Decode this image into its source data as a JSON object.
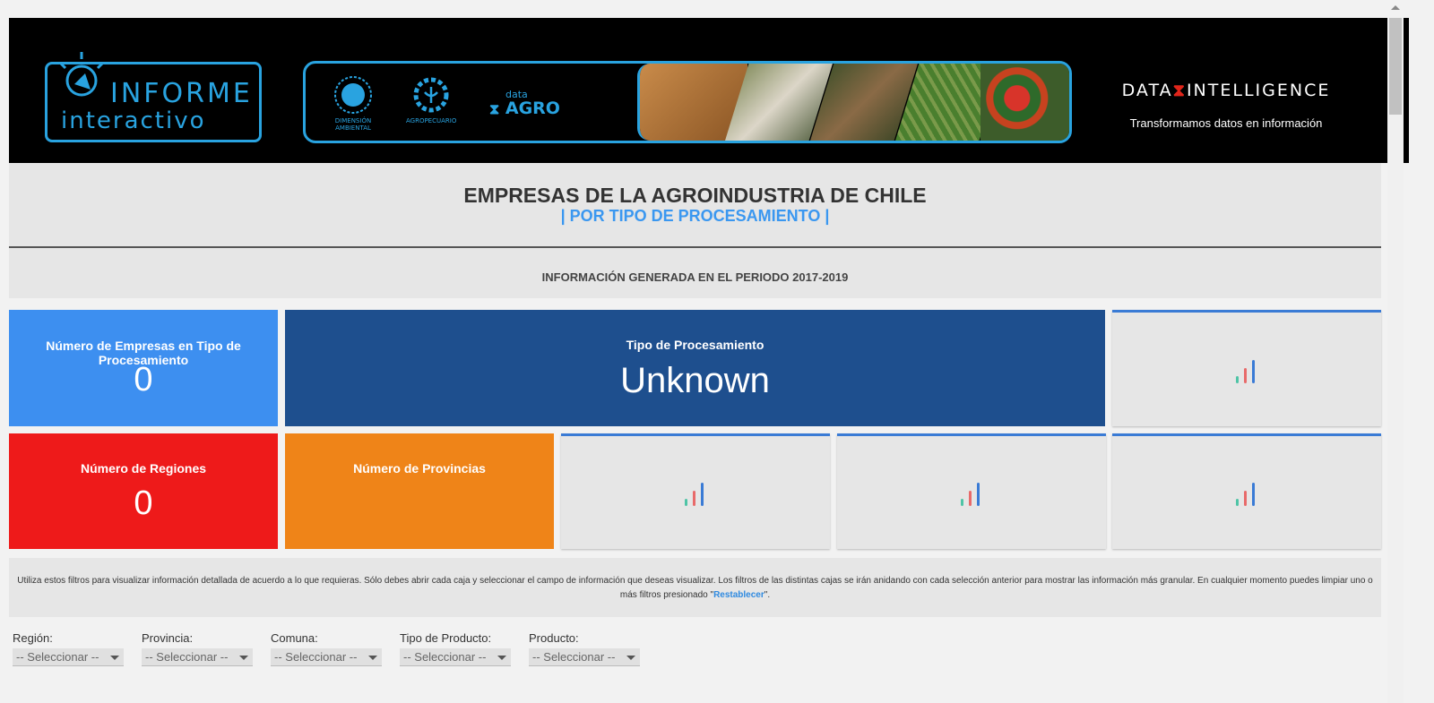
{
  "header": {
    "logo_line1": "INFORME",
    "logo_line2": "interactivo",
    "partners": [
      {
        "label_line1": "DIMENSIÓN",
        "label_line2": "AMBIENTAL",
        "icon": "sun-seal-icon"
      },
      {
        "label_line1": "AGROPECUARIO",
        "label_line2": "",
        "icon": "gear-plant-icon"
      }
    ],
    "data_agro_small": "data",
    "data_agro_big": "AGRO",
    "brand_left": "DATA",
    "brand_right": "INTELLIGENCE",
    "brand_tagline": "Transformamos datos en información"
  },
  "title": {
    "main": "EMPRESAS DE LA AGROINDUSTRIA DE CHILE",
    "sub": "| POR TIPO DE PROCESAMIENTO |",
    "period": "INFORMACIÓN GENERADA EN EL PERIODO 2017-2019"
  },
  "cards": {
    "empresas": {
      "label": "Número de Empresas en Tipo de Procesamiento",
      "value": "0",
      "color": "#3d8ff0"
    },
    "tipo": {
      "label": "Tipo de Procesamiento",
      "value": "Unknown",
      "color": "#1e4f8e"
    },
    "regiones": {
      "label": "Número de Regiones",
      "value": "0",
      "color": "#ee1a1a"
    },
    "provincias": {
      "label": "Número de Provincias",
      "value": "",
      "color": "#ef8418"
    }
  },
  "info": {
    "text_before": "Utiliza estos filtros para visualizar información detallada de acuerdo a lo que requieras. Sólo debes abrir cada caja y seleccionar el campo de información que deseas visualizar. Los filtros de las distintas cajas se irán anidando con cada selección anterior para mostrar las información más granular. En cualquier momento puedes limpiar uno o más filtros presionado \"",
    "link": "Restablecer",
    "text_after": "\"."
  },
  "filters": [
    {
      "label": "Región:",
      "value": "-- Seleccionar --"
    },
    {
      "label": "Provincia:",
      "value": "-- Seleccionar --"
    },
    {
      "label": "Comuna:",
      "value": "-- Seleccionar --"
    },
    {
      "label": "Tipo de Producto:",
      "value": "-- Seleccionar --"
    },
    {
      "label": "Producto:",
      "value": "-- Seleccionar --"
    }
  ],
  "colors": {
    "accent_blue": "#29a3e0",
    "placeholder_bar_teal": "#4fc4a6",
    "placeholder_bar_red": "#e86a6a",
    "placeholder_bar_blue": "#3a7bd5"
  }
}
